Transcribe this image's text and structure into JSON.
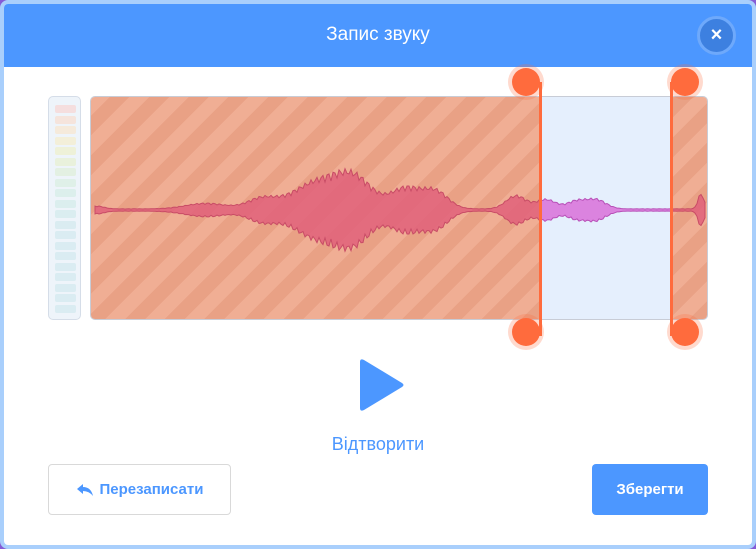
{
  "dialog": {
    "title": "Запис звуку",
    "close_icon": "×"
  },
  "player": {
    "play_label": "Відтворити"
  },
  "buttons": {
    "rerecord_label": "Перезаписати",
    "save_label": "Зберегти"
  },
  "colors": {
    "header": "#4c97ff",
    "trim_handle": "#ff6b3d",
    "waveform_trimmed": "#e0607a",
    "waveform_kept": "#d970d9",
    "button_text": "#4c97ff"
  },
  "icons": {
    "close": "close-icon",
    "play": "play-icon",
    "rerecord": "undo-arrow-icon"
  }
}
